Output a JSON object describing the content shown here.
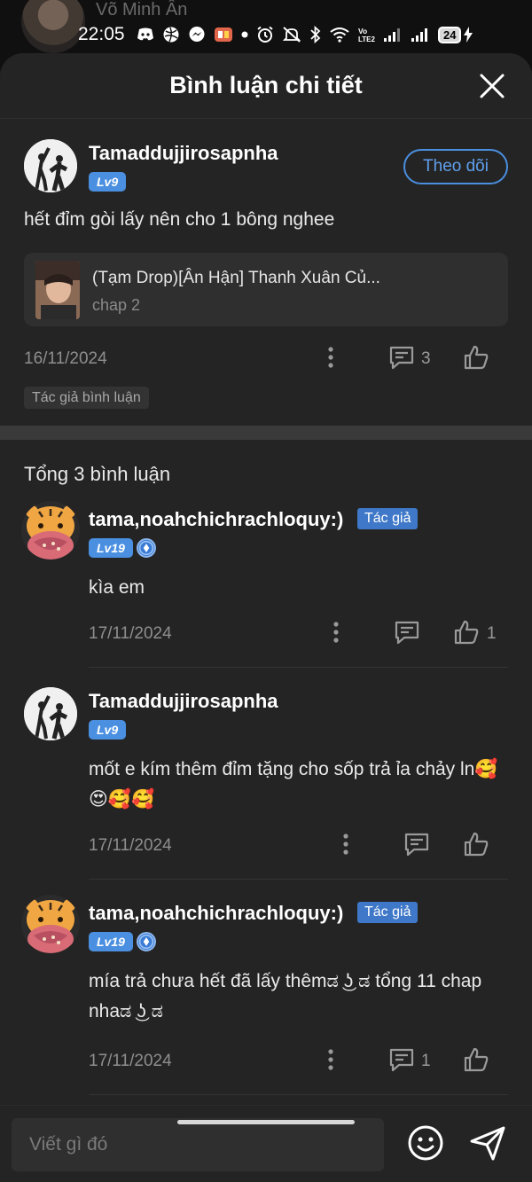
{
  "status_bar": {
    "time": "22:05",
    "background_name": "Võ Minh Ân",
    "battery": "24"
  },
  "header": {
    "title": "Bình luận chi tiết"
  },
  "main_comment": {
    "username": "Tamaddujjirosapnha",
    "level": "Lv9",
    "follow_label": "Theo dõi",
    "text": "hết đỉm gòi lấy nên cho 1 bông nghee",
    "manga": {
      "title": "(Tạm Drop)[Ân Hận] Thanh Xuân Củ...",
      "chapter": "chap 2"
    },
    "date": "16/11/2024",
    "reply_count": "3",
    "tag": "Tác giả bình luận"
  },
  "replies_total": "Tổng 3 bình luận",
  "replies": [
    {
      "username": "tama,noahchichrachloquy:)",
      "author_tag": "Tác giả",
      "level": "Lv19",
      "text": "kìa em",
      "date": "17/11/2024",
      "reply_count": "",
      "like_count": "1"
    },
    {
      "username": "Tamaddujjirosapnha",
      "level": "Lv9",
      "text": "mốt e kím thêm đỉm tặng cho sốp trả ỉa chảy ln🥰😍🥰🥰",
      "date": "17/11/2024",
      "reply_count": "",
      "like_count": ""
    },
    {
      "username": "tama,noahchichrachloquy:)",
      "author_tag": "Tác giả",
      "level": "Lv19",
      "text": "mía trả chưa hết đã lấy thêmಡ ͜ʖ ಡ tổng 11 chap nhaಡ ͜ʖ ಡ",
      "date": "17/11/2024",
      "reply_count": "1",
      "like_count": ""
    }
  ],
  "composer": {
    "placeholder": "Viết gì đó"
  },
  "colors": {
    "accent": "#4a8fe0",
    "sheet_bg": "#242424"
  }
}
